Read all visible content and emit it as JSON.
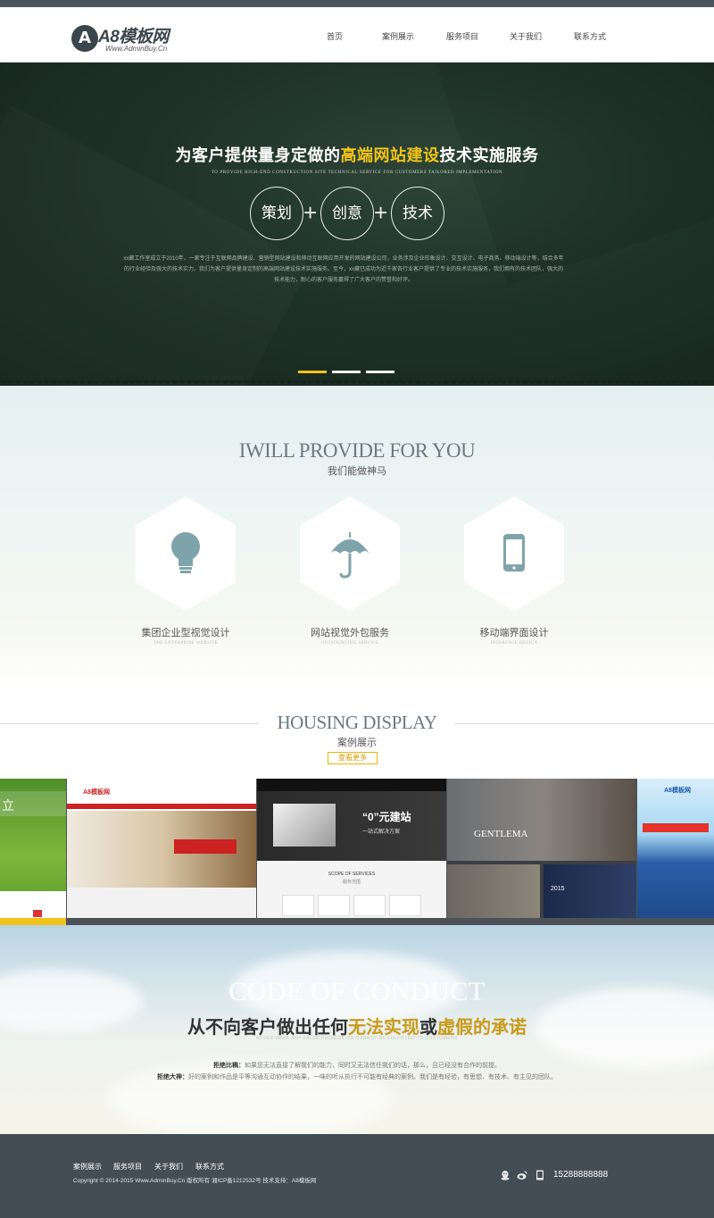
{
  "header": {
    "logo_text": "A8模板网",
    "logo_sub": "Www.AdminBuy.Cn",
    "nav": [
      "首页",
      "案例展示",
      "服务项目",
      "关于我们",
      "联系方式"
    ]
  },
  "hero": {
    "title_pre": "为客户提供量身定做的",
    "title_hl": "高端网站建设",
    "title_post": "技术实施服务",
    "subtitle": "TO PROVIDE HIGH-END CONSTRUCTION SITE TECHNICAL SERVICE FOR CUSTOMERS TAILORED IMPLEMENTATION",
    "circles": [
      "策划",
      "创意",
      "技术"
    ],
    "plus": "+",
    "description": "xx藏工作室成立于2010年，一家专注于互联网品牌建设、营销型网站建设和移动互联网应用开发的网站建设公司，业务涉及企业形象设计、交互设计、电子商务、移动端设计等，结合多年的行业经验及强大的技术实力，我们为客户提供量身定制的高端网站建设技术实施服务。至今，xx藏已成功为近千家各行业客户提供了专业的技术实施服务，我们拥有的技术团队，强大的技术能力，耐心的客户服务赢得了广大客户的赞誉和好评。",
    "slides": 3,
    "active_slide": 0,
    "accent": "#f2c31a"
  },
  "services": {
    "title_en": "IWILL PROVIDE FOR YOU",
    "title_cn": "我们能做神马",
    "items": [
      {
        "icon": "lightbulb-icon",
        "label": "集团企业型视觉设计",
        "sub": "THE ENTERPRISE WEBSITE"
      },
      {
        "icon": "umbrella-icon",
        "label": "网站视觉外包服务",
        "sub": "OUTSOURCING SERVICE"
      },
      {
        "icon": "mobile-icon",
        "label": "移动端界面设计",
        "sub": "INTERFACE DESIGN"
      }
    ],
    "icon_color": "#7fa3ab"
  },
  "cases": {
    "title_en": "HOUSING DISPLAY",
    "title_cn": "案例展示",
    "more": "查看更多",
    "thumbs": [
      {
        "name": "case-green",
        "text": "立"
      },
      {
        "name": "case-interior",
        "text": "A8模板网"
      },
      {
        "name": "case-dark",
        "text": "“0”元建站",
        "sub": "一站式解决方案",
        "scope": "SCOPE OF SERVICES",
        "scope_cn": "服务范围"
      },
      {
        "name": "case-fashion",
        "text": "GENTLEMA",
        "year": "2015"
      },
      {
        "name": "case-blue",
        "text": "A8模板网"
      }
    ]
  },
  "conduct": {
    "title_en": "CODE OF CONDUCT",
    "title_pre": "从不向客户做出任何",
    "title_hl1": "无法实现",
    "title_mid": "或",
    "title_hl2": "虚假的承诺",
    "subtitle": "NEVER MAKE ANY FALSE PROMISE OR CANNOT BE FULFILLED TO CUSTOMERS",
    "line1_label": "拒绝比稿：",
    "line1_text": "如果您无法直接了解我们的能力，同时又无法信任我们的话，那么，且已经没有合作的前提。",
    "line2_label": "拒绝大神：",
    "line2_text": "好的案例和作品是平等沟通互动协作的结果，一味的听从执行不可能有经典的案例。我们是有经验，有思想、有技术、有主见的团队。"
  },
  "footer": {
    "links": [
      "案例展示",
      "服务项目",
      "关于我们",
      "联系方式"
    ],
    "copyright": "Copyright © 2014-2015 Www.AdminBuy.Cn 版权所有  湘ICP备1212532号  技术支持：A8模板网",
    "phone": "15288888888"
  }
}
